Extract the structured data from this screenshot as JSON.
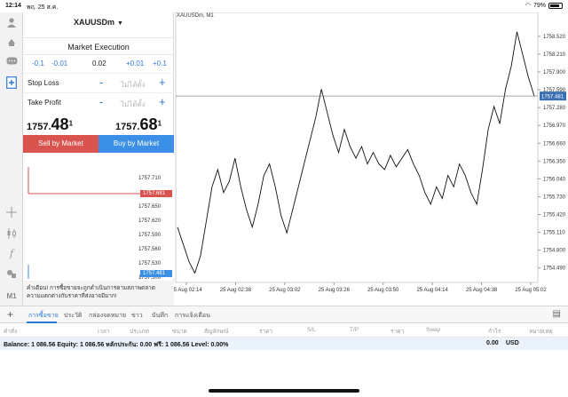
{
  "status": {
    "time": "12:14",
    "date": "พฤ. 25 ส.ค.",
    "battery": "79%"
  },
  "toolbar": {
    "icons": [
      "user-icon",
      "trade-icon",
      "chat-icon",
      "new-order-icon",
      "crosshair-icon",
      "candles-icon",
      "indicator-icon",
      "objects-icon"
    ],
    "timeframe": "M1"
  },
  "order": {
    "symbol": "XAUUSDm",
    "execution": "Market Execution",
    "volume_steps": [
      "-0.1",
      "-0.01",
      "0.02",
      "+0.01",
      "+0.1"
    ],
    "stop_loss_label": "Stop Loss",
    "take_profit_label": "Take Profit",
    "sl_placeholder": "ไม่ได้ตั้ง",
    "tp_placeholder": "ไม่ได้ตั้ง",
    "minus": "-",
    "plus": "+",
    "bid_main": "1757.",
    "bid_big": "48",
    "bid_sup": "1",
    "ask_main": "1757.",
    "ask_big": "68",
    "ask_sup": "1",
    "sell_label": "Sell by Market",
    "buy_label": "Buy by Market",
    "warning": "คำเตือน! การซื้อขายจะถูกดำเนินการตามสภาพตลาด ความแตกต่างกับราคาที่ส่งอาจมีมาก!"
  },
  "mini_chart": {
    "ticks": [
      "1757.710",
      "1757.681",
      "1757.650",
      "1757.620",
      "1757.590",
      "1757.560",
      "1757.530",
      "1757.500",
      "1757.481"
    ],
    "ask_tag": "1757.681",
    "bid_tag": "1757.481",
    "ask_color": "#d9534f",
    "bid_color": "#3b8fe6"
  },
  "chart_data": {
    "type": "line",
    "title": "XAUUSDm, M1",
    "x": [
      "25 Aug 02:14",
      "25 Aug 02:38",
      "25 Aug 03:02",
      "25 Aug 03:26",
      "25 Aug 03:50",
      "25 Aug 04:14",
      "25 Aug 04:38",
      "25 Aug 05:02"
    ],
    "y_ticks": [
      "1758.520",
      "1758.210",
      "1757.900",
      "1757.590",
      "1757.280",
      "1756.970",
      "1756.660",
      "1756.350",
      "1756.040",
      "1755.730",
      "1755.420",
      "1755.110",
      "1754.800",
      "1754.490"
    ],
    "ylim": [
      1754.3,
      1758.75
    ],
    "current_price": 1757.481,
    "current_label": "1757.481",
    "series": [
      {
        "values": [
          1755.2,
          1754.9,
          1754.6,
          1754.4,
          1754.7,
          1755.3,
          1755.9,
          1756.2,
          1755.8,
          1756.0,
          1756.4,
          1755.9,
          1755.5,
          1755.2,
          1755.6,
          1756.1,
          1756.3,
          1755.9,
          1755.4,
          1755.1,
          1755.5,
          1755.9,
          1756.3,
          1756.7,
          1757.1,
          1757.6,
          1757.2,
          1756.8,
          1756.5,
          1756.9,
          1756.6,
          1756.4,
          1756.6,
          1756.3,
          1756.5,
          1756.3,
          1756.2,
          1756.45,
          1756.25,
          1756.4,
          1756.55,
          1756.3,
          1756.1,
          1755.8,
          1755.6,
          1755.9,
          1755.7,
          1756.1,
          1755.9,
          1756.3,
          1756.1,
          1755.8,
          1755.6,
          1756.2,
          1756.9,
          1757.3,
          1757.0,
          1757.6,
          1758.0,
          1758.6,
          1758.2,
          1757.8,
          1757.48
        ]
      }
    ],
    "line_color": "#111111",
    "grid": false
  },
  "tabs": {
    "items": [
      "การซื้อขาย",
      "ประวัติ",
      "กล่องจดหมาย",
      "ข่าว",
      "บันทึก",
      "การแจ้งเตือน"
    ],
    "active_index": 0
  },
  "table_heads": [
    "คำสั่ง",
    "เวลา",
    "ประเภท",
    "ขนาด",
    "สัญลักษณ์",
    "ราคา",
    "S/L",
    "T/P",
    "ราคา",
    "Swap",
    "กำไร",
    "หมายเหตุ"
  ],
  "balance": {
    "text": "Balance: 1 086.56 Equity: 1 086.56 หลักประกัน: 0.00 ฟรี: 1 086.56 Level: 0.00%",
    "amount": "0.00",
    "currency": "USD"
  }
}
